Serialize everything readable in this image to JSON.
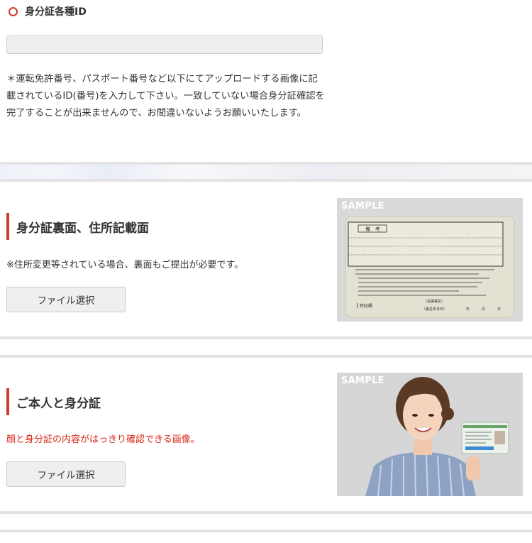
{
  "id_section": {
    "heading": "身分証各種ID",
    "input_value": "",
    "note": "＊運転免許番号、パスポート番号など以下にてアップロードする画像に記載されているID(番号)を入力して下さい。一致していない場合身分証確認を完了することが出来ませんので、お間違いないようお願いいたします。"
  },
  "back_section": {
    "title": "身分証裏面、住所記載面",
    "note": "※住所変更等されている場合、裏面もご提出が必要です。",
    "button_label": "ファイル選択",
    "sample_label": "SAMPLE",
    "card_header": "備　考",
    "card_footer_left": "【  特記欄",
    "card_footer_mid_1": "（自署署名）",
    "card_footer_mid_2": "（署名年月日）",
    "card_footer_right_1": "年",
    "card_footer_right_2": "月",
    "card_footer_right_3": "日"
  },
  "selfie_section": {
    "title": "ご本人と身分証",
    "note": "顔と身分証の内容がはっきり確認できる画像。",
    "button_label": "ファイル選択",
    "sample_label": "SAMPLE"
  },
  "colors": {
    "accent_red": "#d23a28",
    "note_red": "#d8281c",
    "separator": "#e3e3e3"
  }
}
